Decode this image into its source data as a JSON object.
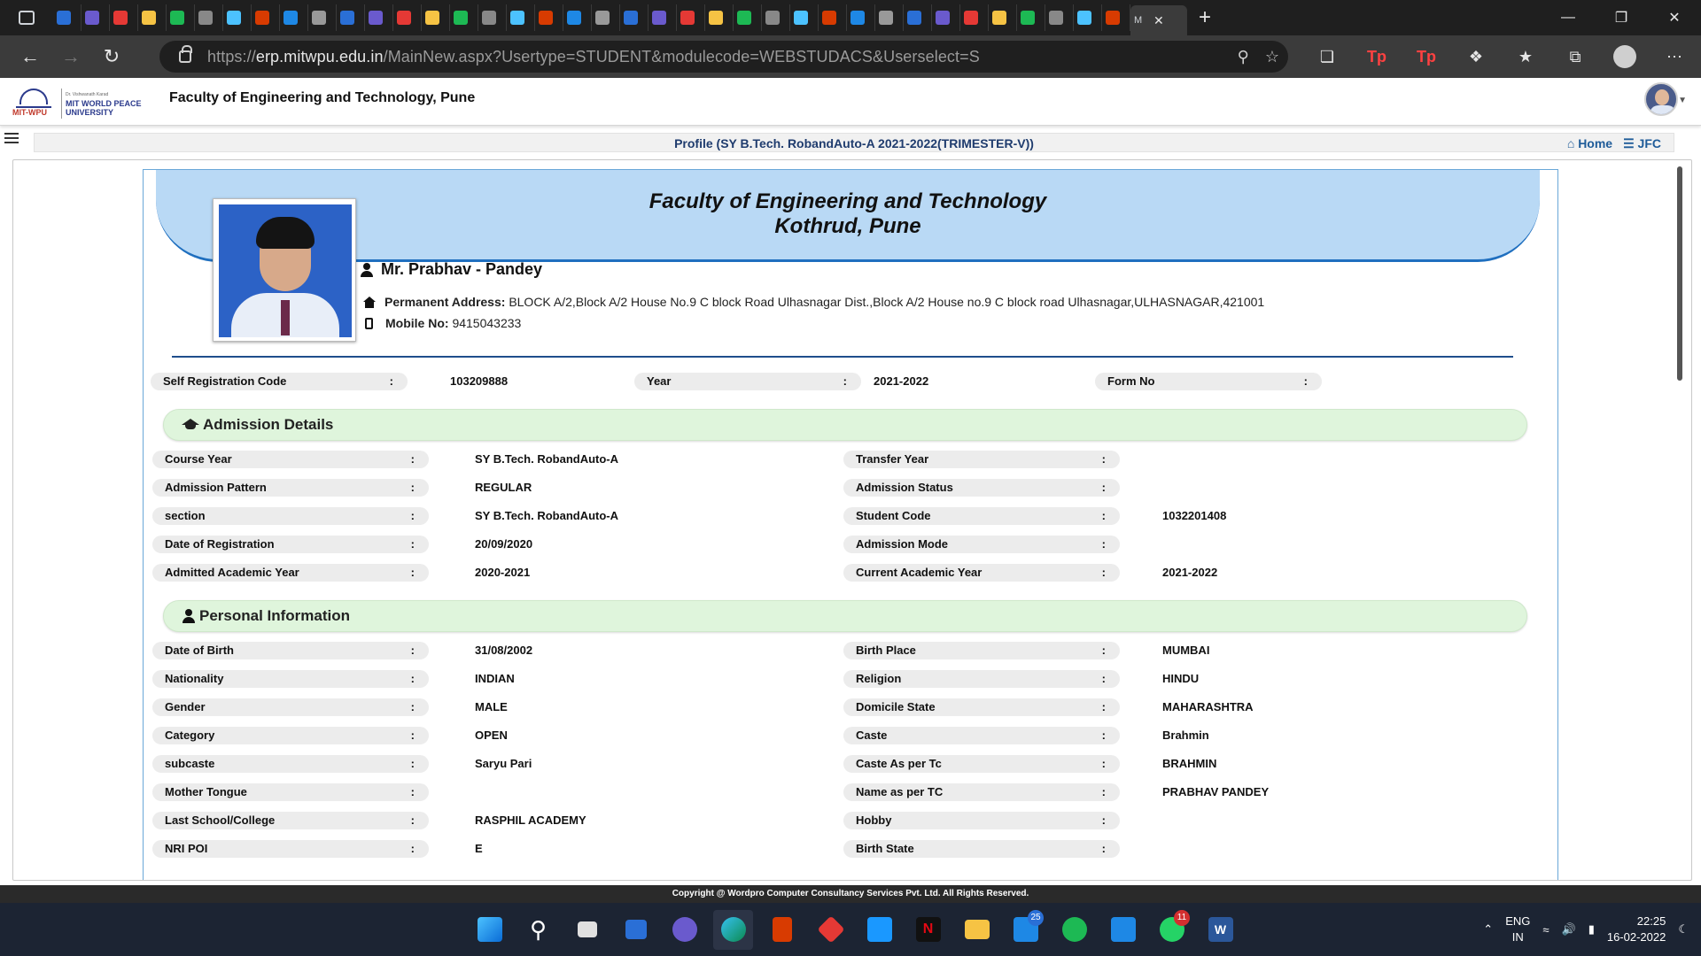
{
  "browser": {
    "tab_count_visible": 38,
    "active_tab_title": "M",
    "url_proto": "https://",
    "url_host": "erp.mitwpu.edu.in",
    "url_path": "/MainNew.aspx?Usertype=STUDENT&modulecode=WEBSTUDACS&Userselect=S",
    "ext_tp_1": "Tp",
    "ext_tp_2": "Tp"
  },
  "app": {
    "faculty_title": "Faculty of Engineering and Technology, Pune",
    "logo_text": "MIT WORLD PEACE UNIVERSITY",
    "logo_short": "MIT-WPU",
    "logo_small": "Dr. Vishwanath Karad"
  },
  "breadcrumb": {
    "title": "Profile  (SY B.Tech. RobandAuto-A   2021-2022(TRIMESTER-V))",
    "home": "Home",
    "jfc": "JFC"
  },
  "banner": {
    "line1": "Faculty of Engineering and Technology",
    "line2": "Kothrud, Pune"
  },
  "student": {
    "name": "Mr. Prabhav - Pandey",
    "address_label": "Permanent Address:",
    "address": "BLOCK A/2,Block A/2 House No.9 C block Road Ulhasnagar Dist.,Block A/2 House no.9 C block road Ulhasnagar,ULHASNAGAR,421001",
    "mobile_label": "Mobile No:",
    "mobile": "9415043233"
  },
  "top_fields": [
    {
      "label": "Self Registration Code",
      "value": "103209888"
    },
    {
      "label": "Year",
      "value": "2021-2022"
    },
    {
      "label": "Form No",
      "value": ""
    }
  ],
  "colon": ":",
  "admission": {
    "title": "Admission Details",
    "rows": [
      {
        "l1": "Course Year",
        "v1": "SY B.Tech. RobandAuto-A",
        "l2": "Transfer Year",
        "v2": ""
      },
      {
        "l1": "Admission Pattern",
        "v1": "REGULAR",
        "l2": "Admission Status",
        "v2": ""
      },
      {
        "l1": "section",
        "v1": "SY B.Tech. RobandAuto-A",
        "l2": "Student Code",
        "v2": "1032201408"
      },
      {
        "l1": "Date of Registration",
        "v1": "20/09/2020",
        "l2": "Admission Mode",
        "v2": ""
      },
      {
        "l1": "Admitted Academic Year",
        "v1": "2020-2021",
        "l2": "Current Academic Year",
        "v2": "2021-2022"
      }
    ]
  },
  "personal": {
    "title": "Personal Information",
    "rows": [
      {
        "l1": "Date of Birth",
        "v1": "31/08/2002",
        "l2": "Birth Place",
        "v2": "MUMBAI"
      },
      {
        "l1": "Nationality",
        "v1": "INDIAN",
        "l2": "Religion",
        "v2": "HINDU"
      },
      {
        "l1": "Gender",
        "v1": "MALE",
        "l2": "Domicile State",
        "v2": "MAHARASHTRA"
      },
      {
        "l1": "Category",
        "v1": "OPEN",
        "l2": "Caste",
        "v2": "Brahmin"
      },
      {
        "l1": "subcaste",
        "v1": "Saryu Pari",
        "l2": "Caste As per Tc",
        "v2": "BRAHMIN"
      },
      {
        "l1": "Mother Tongue",
        "v1": "",
        "l2": "Name as per TC",
        "v2": "PRABHAV PANDEY"
      },
      {
        "l1": "Last School/College",
        "v1": "RASPHIL ACADEMY",
        "l2": "Hobby",
        "v2": ""
      },
      {
        "l1": "NRI POI",
        "v1": "E",
        "l2": "Birth State",
        "v2": ""
      }
    ]
  },
  "footer": {
    "copyright": "Copyright @ Wordpro Computer Consultancy Services Pvt. Ltd. All Rights Reserved."
  },
  "taskbar": {
    "mail_badge": "25",
    "whatsapp_badge": "11",
    "lang1": "ENG",
    "lang2": "IN",
    "time": "22:25",
    "date": "16-02-2022"
  },
  "colors": {
    "banner": "#b9d9f5",
    "section": "#dff5dc",
    "accent": "#1f4e8c"
  }
}
